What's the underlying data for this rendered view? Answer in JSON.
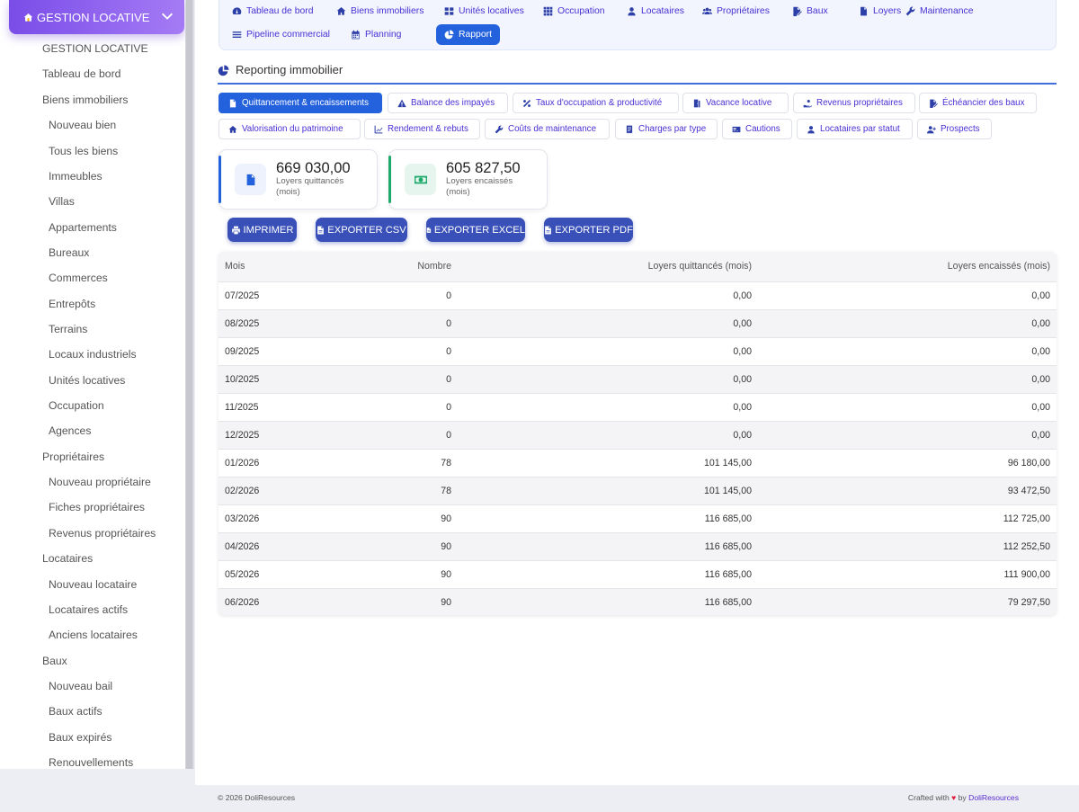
{
  "sidebar": {
    "module_label": "GESTION LOCATIVE",
    "items": [
      {
        "label": "GESTION LOCATIVE",
        "sub": false
      },
      {
        "label": "Tableau de bord",
        "sub": false
      },
      {
        "label": "Biens immobiliers",
        "sub": false
      },
      {
        "label": "Nouveau bien",
        "sub": true
      },
      {
        "label": "Tous les biens",
        "sub": true
      },
      {
        "label": "Immeubles",
        "sub": true
      },
      {
        "label": "Villas",
        "sub": true
      },
      {
        "label": "Appartements",
        "sub": true
      },
      {
        "label": "Bureaux",
        "sub": true
      },
      {
        "label": "Commerces",
        "sub": true
      },
      {
        "label": "Entrepôts",
        "sub": true
      },
      {
        "label": "Terrains",
        "sub": true
      },
      {
        "label": "Locaux industriels",
        "sub": true
      },
      {
        "label": "Unités locatives",
        "sub": true
      },
      {
        "label": "Occupation",
        "sub": true
      },
      {
        "label": "Agences",
        "sub": true
      },
      {
        "label": "Propriétaires",
        "sub": false
      },
      {
        "label": "Nouveau propriétaire",
        "sub": true
      },
      {
        "label": "Fiches propriétaires",
        "sub": true
      },
      {
        "label": "Revenus propriétaires",
        "sub": true
      },
      {
        "label": "Locataires",
        "sub": false
      },
      {
        "label": "Nouveau locataire",
        "sub": true
      },
      {
        "label": "Locataires actifs",
        "sub": true
      },
      {
        "label": "Anciens locataires",
        "sub": true
      },
      {
        "label": "Baux",
        "sub": false
      },
      {
        "label": "Nouveau bail",
        "sub": true
      },
      {
        "label": "Baux actifs",
        "sub": true
      },
      {
        "label": "Baux expirés",
        "sub": true
      },
      {
        "label": "Renouvellements",
        "sub": true
      }
    ]
  },
  "topnav": {
    "items": [
      {
        "label": "Tableau de bord",
        "icon": "dashboard-icon"
      },
      {
        "label": "Biens immobiliers",
        "icon": "home-icon"
      },
      {
        "label": "Unités locatives",
        "icon": "grid-icon"
      },
      {
        "label": "Occupation",
        "icon": "grid-dots-icon"
      },
      {
        "label": "Locataires",
        "icon": "user-icon"
      },
      {
        "label": "Propriétaires",
        "icon": "users-icon"
      },
      {
        "label": "Baux",
        "icon": "file-signature-icon"
      },
      {
        "label": "Loyers",
        "icon": "document-icon"
      },
      {
        "label": "Maintenance",
        "icon": "wrench-icon"
      },
      {
        "label": "Pipeline commercial",
        "icon": "list-icon"
      },
      {
        "label": "Planning",
        "icon": "calendar-icon"
      },
      {
        "label": "Rapport",
        "icon": "pie-chart-icon",
        "active": true
      }
    ]
  },
  "section": {
    "title": "Reporting immobilier"
  },
  "report_tabs": [
    {
      "label": "Quittancement & encaissements",
      "icon": "document-icon",
      "active": true
    },
    {
      "label": "Balance des impayés",
      "icon": "warning-icon"
    },
    {
      "label": "Taux d'occupation & productivité",
      "icon": "percent-icon"
    },
    {
      "label": "Vacance locative",
      "icon": "door-icon"
    },
    {
      "label": "Revenus propriétaires",
      "icon": "hand-coins-icon"
    },
    {
      "label": "Échéancier des baux",
      "icon": "file-signature-icon"
    },
    {
      "label": "Valorisation du patrimoine",
      "icon": "home-icon"
    },
    {
      "label": "Rendement & rebuts",
      "icon": "line-chart-icon"
    },
    {
      "label": "Coûts de maintenance",
      "icon": "wrench-icon"
    },
    {
      "label": "Charges par type",
      "icon": "receipt-icon"
    },
    {
      "label": "Cautions",
      "icon": "card-icon"
    },
    {
      "label": "Locataires par statut",
      "icon": "user-icon"
    },
    {
      "label": "Prospects",
      "icon": "user-plus-icon"
    }
  ],
  "kpis": [
    {
      "value": "669 030,00",
      "label": "Loyers quittancés (mois)",
      "accent": "#2461dd",
      "icon": "document-icon"
    },
    {
      "value": "605 827,50",
      "label": "Loyers encaissés (mois)",
      "accent": "#1faa6b",
      "icon": "money-icon"
    }
  ],
  "export_buttons": [
    {
      "label": "IMPRIMER",
      "icon": "print-icon"
    },
    {
      "label": "EXPORTER CSV",
      "icon": "file-csv-icon"
    },
    {
      "label": "EXPORTER EXCEL",
      "icon": "file-excel-icon"
    },
    {
      "label": "EXPORTER PDF",
      "icon": "file-pdf-icon"
    }
  ],
  "table": {
    "headers": [
      "Mois",
      "Nombre",
      "Loyers quittancés (mois)",
      "Loyers encaissés (mois)"
    ],
    "rows": [
      [
        "07/2025",
        "0",
        "0,00",
        "0,00"
      ],
      [
        "08/2025",
        "0",
        "0,00",
        "0,00"
      ],
      [
        "09/2025",
        "0",
        "0,00",
        "0,00"
      ],
      [
        "10/2025",
        "0",
        "0,00",
        "0,00"
      ],
      [
        "11/2025",
        "0",
        "0,00",
        "0,00"
      ],
      [
        "12/2025",
        "0",
        "0,00",
        "0,00"
      ],
      [
        "01/2026",
        "78",
        "101 145,00",
        "96 180,00"
      ],
      [
        "02/2026",
        "78",
        "101 145,00",
        "93 472,50"
      ],
      [
        "03/2026",
        "90",
        "116 685,00",
        "112 725,00"
      ],
      [
        "04/2026",
        "90",
        "116 685,00",
        "112 252,50"
      ],
      [
        "05/2026",
        "90",
        "116 685,00",
        "111 900,00"
      ],
      [
        "06/2026",
        "90",
        "116 685,00",
        "79 297,50"
      ]
    ]
  },
  "footer": {
    "copyright": "© 2026 DoliResources",
    "crafted_prefix": "Crafted with",
    "heart": "♥",
    "crafted_by": "by",
    "brand": "DoliResources"
  }
}
